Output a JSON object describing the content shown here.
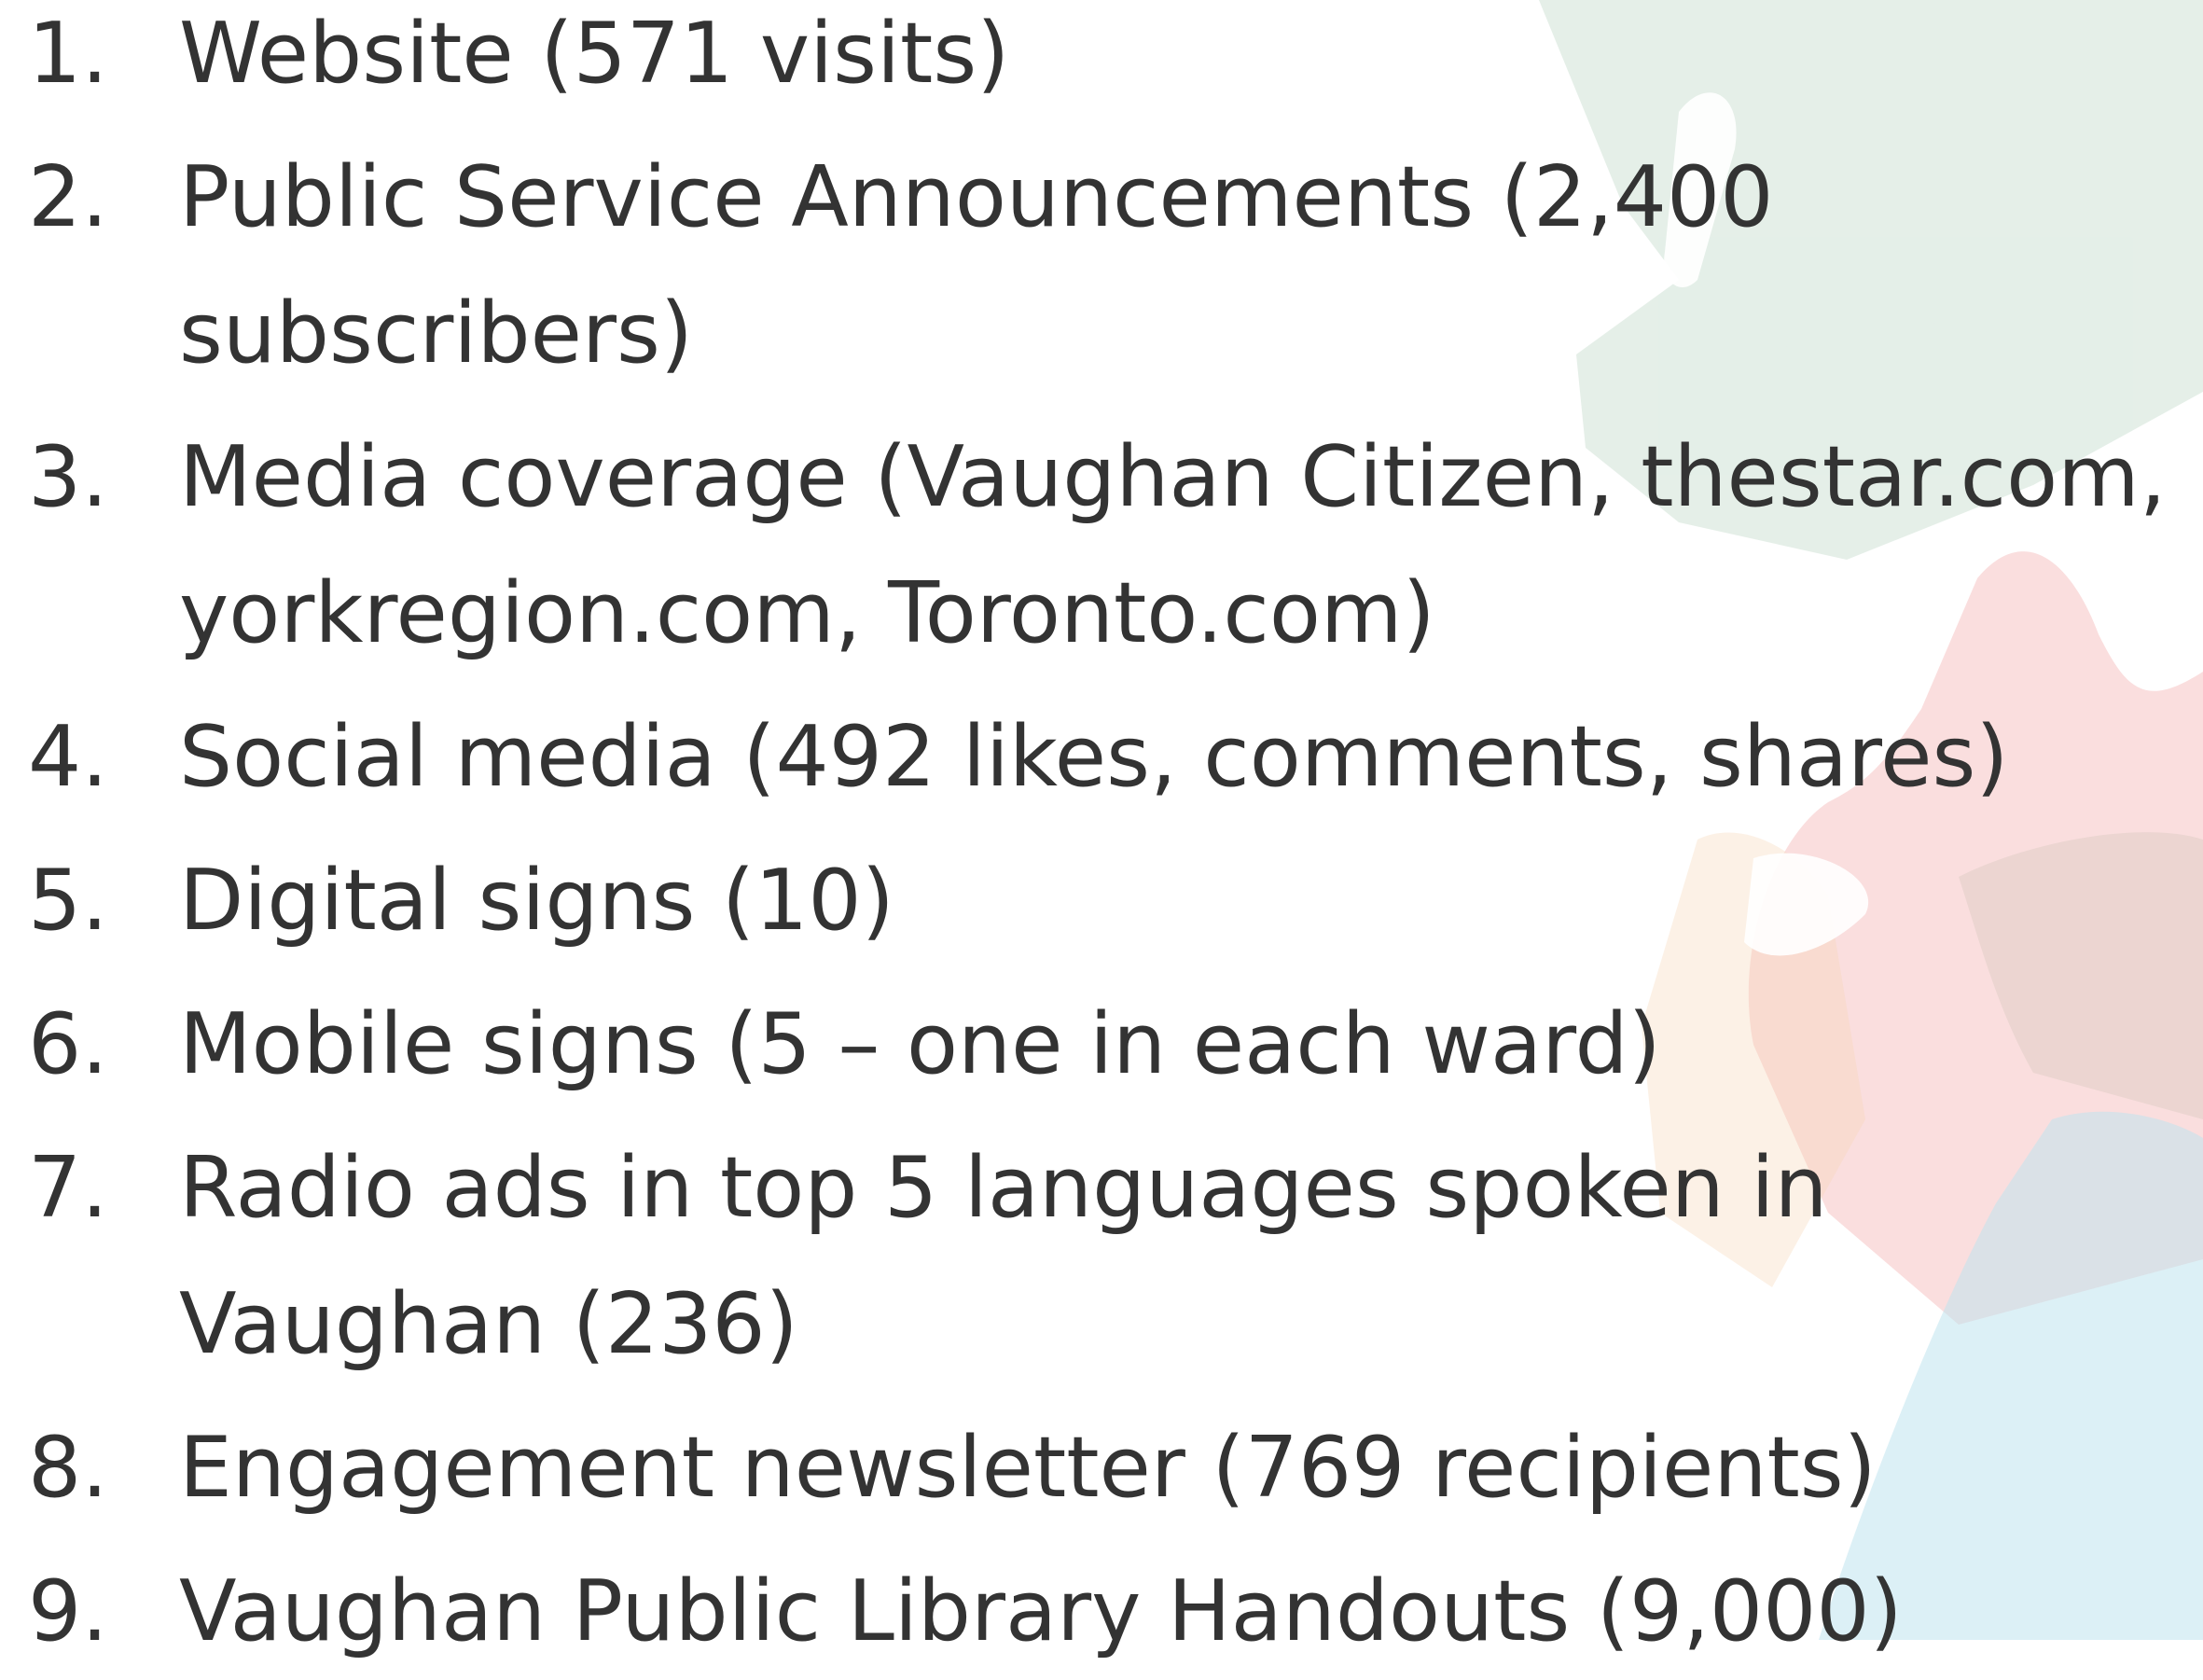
{
  "colors": {
    "text": "#333333",
    "background": "#ffffff",
    "hand_green": "#cfe2d6",
    "hand_red": "#f4b5b5",
    "hand_blue": "#bfe3ee",
    "hand_orange": "#f7d6b8"
  },
  "list": [
    {
      "number": "1.",
      "text": "Website (571 visits)"
    },
    {
      "number": "2.",
      "text": "Public Service Announcements (2,400 subscribers)"
    },
    {
      "number": "3.",
      "text": "Media coverage (Vaughan Citizen, thestar.com, yorkregion.com, Toronto.com)"
    },
    {
      "number": "4.",
      "text": "Social media (492 likes, comments, shares)"
    },
    {
      "number": "5.",
      "text": "Digital signs (10)"
    },
    {
      "number": "6.",
      "text": "Mobile signs (5 – one in each ward)"
    },
    {
      "number": "7.",
      "text": "Radio ads in top 5 languages spoken in Vaughan (236)"
    },
    {
      "number": "8.",
      "text": "Engagement newsletter (769 recipients)"
    },
    {
      "number": "9.",
      "text": "Vaughan Public Library Handouts (9,000)"
    }
  ]
}
